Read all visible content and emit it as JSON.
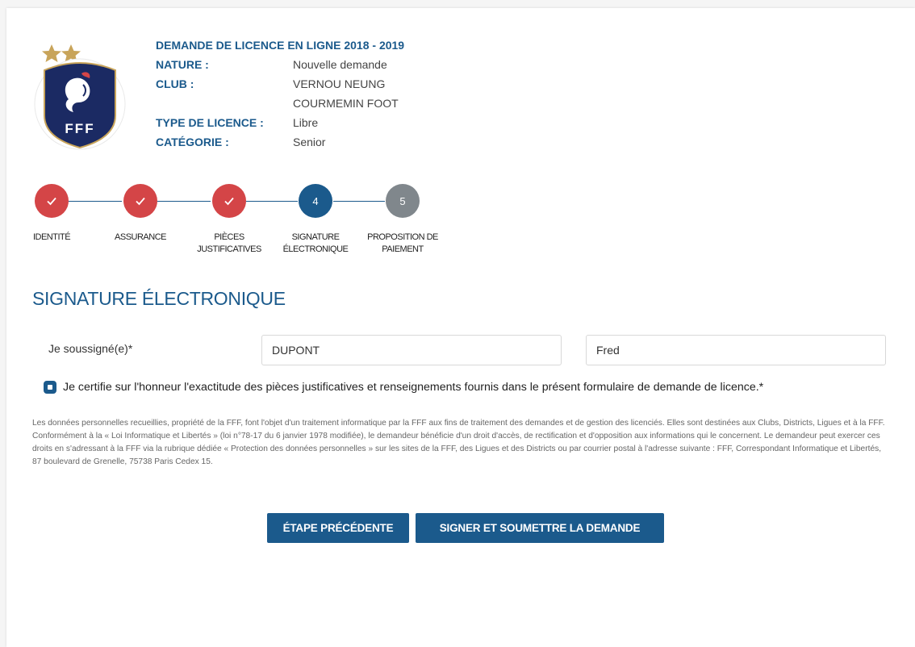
{
  "header": {
    "title": "DEMANDE DE LICENCE EN LIGNE 2018 - 2019",
    "rows": [
      {
        "label": "NATURE :",
        "value": "Nouvelle demande"
      },
      {
        "label": "CLUB :",
        "value": "VERNOU NEUNG"
      },
      {
        "label": "",
        "value": "COURMEMIN FOOT"
      },
      {
        "label": "TYPE DE LICENCE :",
        "value": "Libre"
      },
      {
        "label": "CATÉGORIE :",
        "value": "Senior"
      }
    ],
    "logo_text": "FFF"
  },
  "steps": [
    {
      "number": "1",
      "line1": "IDENTITÉ",
      "line2": "",
      "status": "done"
    },
    {
      "number": "2",
      "line1": "ASSURANCE",
      "line2": "",
      "status": "done"
    },
    {
      "number": "3",
      "line1": "PIÈCES",
      "line2": "JUSTIFICATIVES",
      "status": "done"
    },
    {
      "number": "4",
      "line1": "SIGNATURE",
      "line2": "ÉLECTRONIQUE",
      "status": "active"
    },
    {
      "number": "5",
      "line1": "PROPOSITION DE",
      "line2": "PAIEMENT",
      "status": "todo"
    }
  ],
  "section": {
    "title": "SIGNATURE ÉLECTRONIQUE",
    "signer_label": "Je soussigné(e)*",
    "last_name": "DUPONT",
    "first_name": "Fred",
    "certify_text": "Je certifie sur l'honneur l'exactitude des pièces justificatives et renseignements fournis dans le présent formulaire de demande de licence.*",
    "certify_checked": true,
    "legal_text": "Les données personnelles recueillies, propriété de la FFF, font l'objet d'un traitement informatique par la FFF aux fins de traitement des demandes et de gestion des licenciés. Elles sont destinées aux Clubs, Districts, Ligues et à la FFF. Conformément à la « Loi Informatique et Libertés » (loi n°78-17 du 6 janvier 1978 modifiée), le demandeur bénéficie d'un droit d'accès, de rectification et d'opposition aux informations qui le concernent. Le demandeur peut exercer ces droits en s'adressant à la FFF via la rubrique dédiée « Protection des données personnelles » sur les sites de la FFF, des Ligues et des Districts ou par courrier postal à l'adresse suivante : FFF, Correspondant Informatique et Libertés, 87 boulevard de Grenelle, 75738 Paris Cedex 15."
  },
  "buttons": {
    "previous": "ÉTAPE PRÉCÉDENTE",
    "submit": "SIGNER ET SOUMETTRE LA DEMANDE"
  },
  "colors": {
    "primary": "#1b5a8c",
    "done": "#d44547",
    "todo": "#80878c"
  }
}
